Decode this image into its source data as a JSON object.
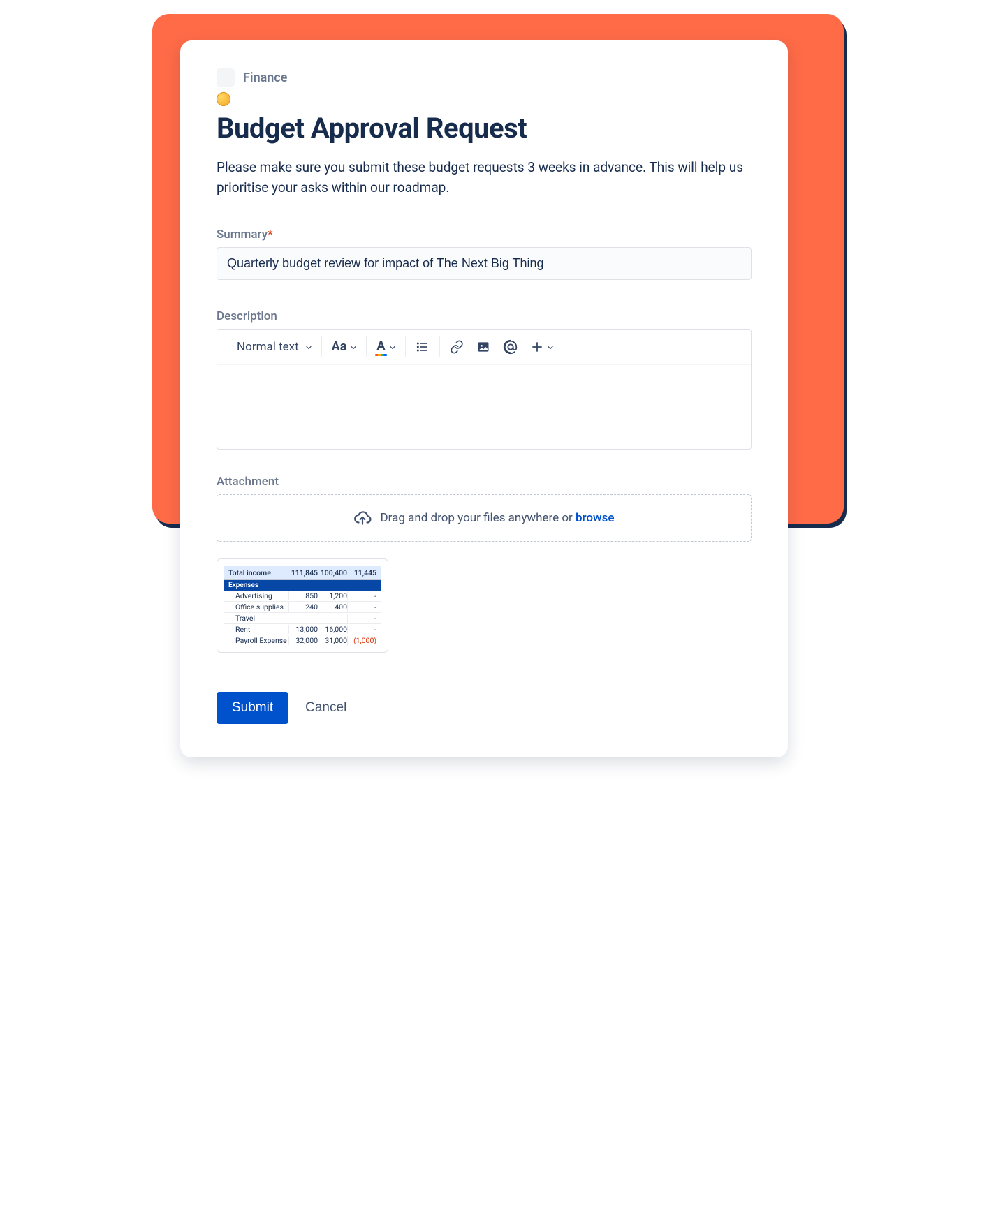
{
  "breadcrumb": {
    "category": "Finance"
  },
  "page": {
    "title": "Budget Approval Request",
    "intro": "Please make sure you submit these budget requests 3 weeks in advance. This will help us prioritise your asks within our roadmap."
  },
  "fields": {
    "summary_label": "Summary",
    "summary_value": "Quarterly budget review for impact of The Next Big Thing",
    "description_label": "Description",
    "text_style_label": "Normal text",
    "attachment_label": "Attachment",
    "drop_text": "Drag and drop your files anywhere or ",
    "browse_text": "browse"
  },
  "attachment_preview": {
    "header_label": "Total income",
    "header_v1": "111,845",
    "header_v2": "100,400",
    "header_diff": "11,445",
    "section": "Expenses",
    "rows": [
      {
        "label": "Advertising",
        "v1": "850",
        "v2": "1,200",
        "diff": "-"
      },
      {
        "label": "Office supplies",
        "v1": "240",
        "v2": "400",
        "diff": "-"
      },
      {
        "label": "Travel",
        "v1": "",
        "v2": "",
        "diff": "-"
      },
      {
        "label": "Rent",
        "v1": "13,000",
        "v2": "16,000",
        "diff": "-"
      },
      {
        "label": "Payroll Expense",
        "v1": "32,000",
        "v2": "31,000",
        "diff": "(1,000)",
        "neg": true
      }
    ]
  },
  "actions": {
    "submit": "Submit",
    "cancel": "Cancel"
  }
}
